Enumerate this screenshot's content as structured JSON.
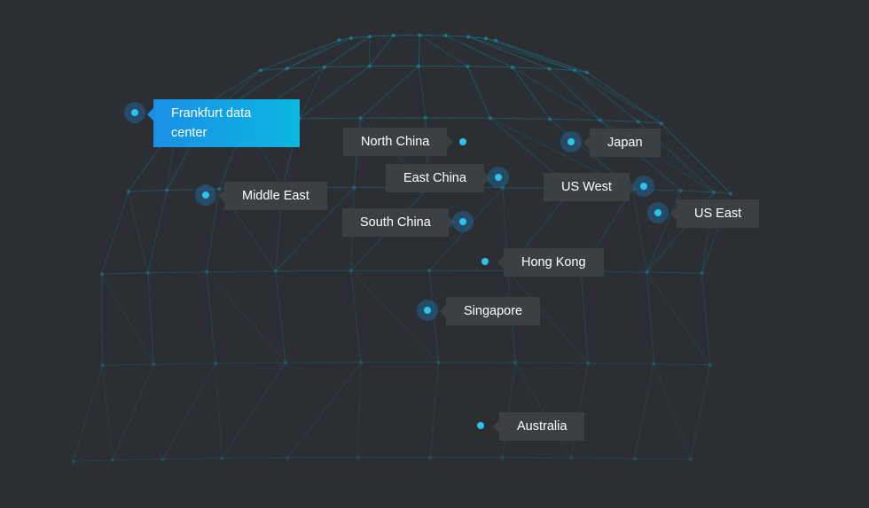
{
  "theme": {
    "background": "#2b2f33",
    "label_background": "#3b4045",
    "label_text": "#ffffff",
    "marker_color": "#2ec4e8",
    "marker_halo": "#1f6eaa",
    "active_gradient_start": "#1a8fe6",
    "active_gradient_end": "#0ab8e0",
    "globe_line_color": "#1b6f80"
  },
  "locations": {
    "frankfurt": {
      "label": "Frankfurt data center",
      "active": true
    },
    "north_china": {
      "label": "North China"
    },
    "japan": {
      "label": "Japan"
    },
    "east_china": {
      "label": "East China"
    },
    "us_west": {
      "label": "US West"
    },
    "us_east": {
      "label": "US East"
    },
    "middle_east": {
      "label": "Middle East"
    },
    "south_china": {
      "label": "South China"
    },
    "hong_kong": {
      "label": "Hong Kong"
    },
    "singapore": {
      "label": "Singapore"
    },
    "australia": {
      "label": "Australia"
    }
  }
}
